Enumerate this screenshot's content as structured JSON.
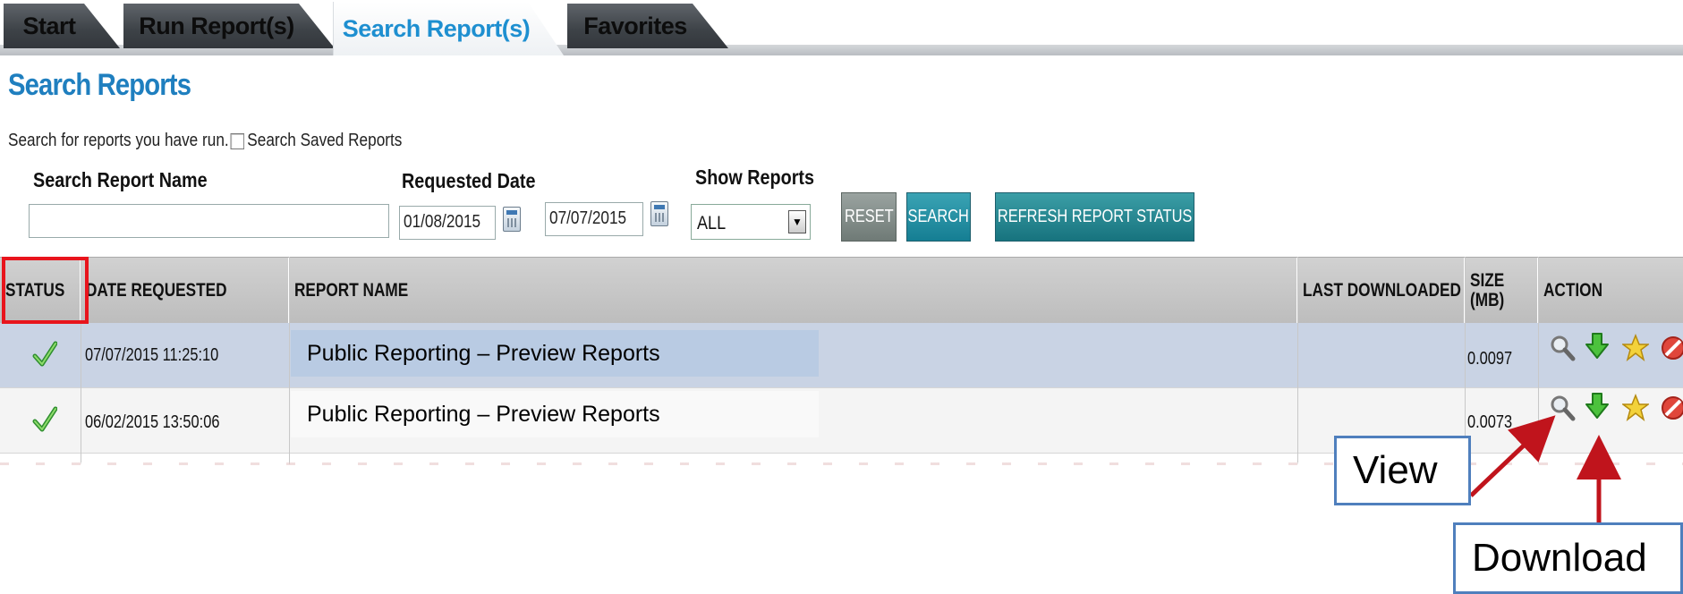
{
  "tabs": [
    {
      "label": "Start"
    },
    {
      "label": "Run Report(s)"
    },
    {
      "label": "Search Report(s)"
    },
    {
      "label": "Favorites"
    }
  ],
  "page_title": "Search Reports",
  "intro_text": "Search for reports you have run.",
  "saved_reports_label": "Search Saved Reports",
  "form": {
    "report_name_label": "Search Report Name",
    "report_name_value": "",
    "requested_date_label": "Requested Date",
    "date_from": "01/08/2015",
    "date_to": "07/07/2015",
    "show_reports_label": "Show Reports",
    "show_reports_value": "ALL",
    "reset_label": "RESET",
    "search_label": "SEARCH",
    "refresh_label": "REFRESH REPORT STATUS"
  },
  "table": {
    "headers": {
      "status": "STATUS",
      "date_requested": "DATE REQUESTED",
      "report_name": "REPORT NAME",
      "last_downloaded": "LAST DOWNLOADED",
      "size": "SIZE (MB)",
      "action": "ACTION"
    },
    "rows": [
      {
        "status_icon": "check-icon",
        "date_requested": "07/07/2015 11:25:10",
        "report_name": "Public Reporting – Preview Reports",
        "last_downloaded": "",
        "size": "0.0097"
      },
      {
        "status_icon": "check-icon",
        "date_requested": "06/02/2015 13:50:06",
        "report_name": "Public Reporting – Preview Reports",
        "last_downloaded": "",
        "size": "0.0073"
      }
    ],
    "action_icons": [
      "view-icon",
      "download-icon",
      "favorite-icon",
      "delete-icon"
    ]
  },
  "callouts": {
    "view": "View",
    "download": "Download"
  },
  "colors": {
    "title_blue": "#1f7fbf",
    "active_tab_text": "#1e8fd0",
    "highlight_red": "#e8141c",
    "callout_border": "#4f7fbd",
    "arrow_red": "#c0141c"
  }
}
